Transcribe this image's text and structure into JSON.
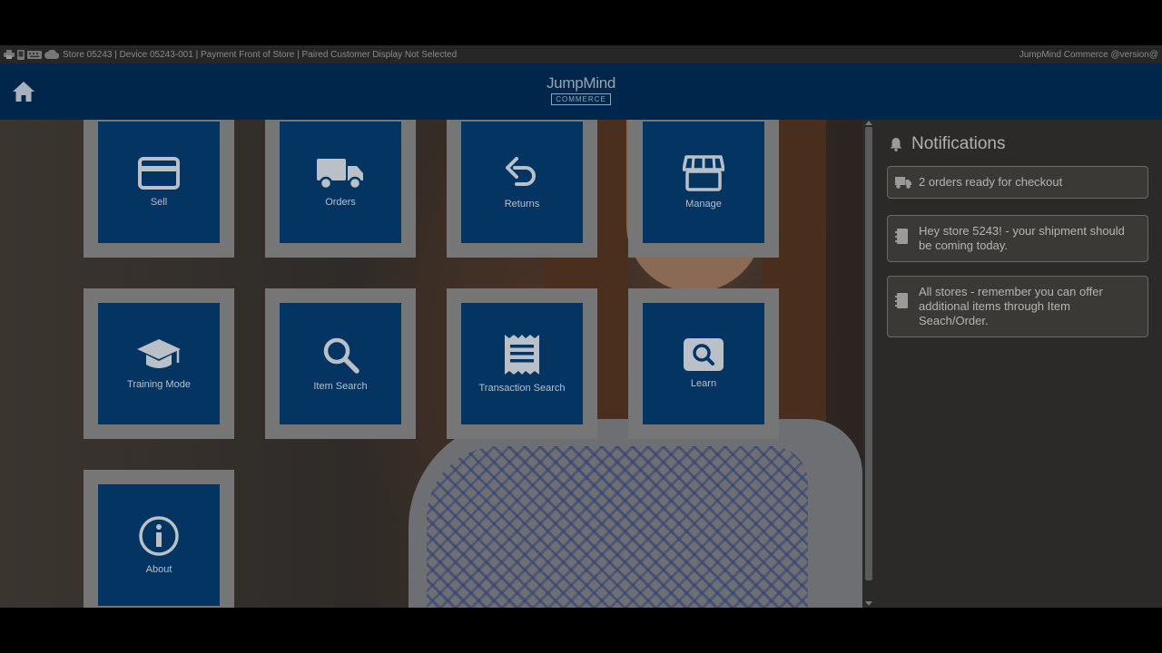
{
  "status_bar": {
    "left_text": "Store 05243 | Device 05243-001 | Payment Front of Store | Paired Customer Display Not Selected",
    "right_text": "JumpMind Commerce @version@",
    "icons": [
      "printer-icon",
      "phone-icon",
      "keyboard-icon",
      "cloud-icon"
    ]
  },
  "header": {
    "home_icon": "home-icon",
    "logo_text": "JumpMind",
    "logo_sub": "COMMERCE",
    "color": "#00274b"
  },
  "tiles": [
    {
      "label": "Sell",
      "icon": "credit-card-icon"
    },
    {
      "label": "Orders",
      "icon": "truck-icon"
    },
    {
      "label": "Returns",
      "icon": "undo-icon"
    },
    {
      "label": "Manage",
      "icon": "store-icon"
    },
    {
      "label": "Training Mode",
      "icon": "graduation-cap-icon"
    },
    {
      "label": "Item Search",
      "icon": "magnifier-icon"
    },
    {
      "label": "Transaction Search",
      "icon": "receipt-icon"
    },
    {
      "label": "Learn",
      "icon": "search-box-icon"
    },
    {
      "label": "About",
      "icon": "info-icon"
    }
  ],
  "notifications": {
    "title": "Notifications",
    "items": [
      {
        "text": "2 orders ready for checkout",
        "icon": "truck-icon"
      },
      {
        "text": "Hey store 5243! - your shipment should be coming today.",
        "icon": "book-icon"
      },
      {
        "text": "All stores - remember you can offer additional items through Item Seach/Order.",
        "icon": "book-icon"
      }
    ]
  },
  "colors": {
    "tile_blue": "#033462",
    "tile_frame": "#767676",
    "panel_bg": "#2c2a28"
  }
}
